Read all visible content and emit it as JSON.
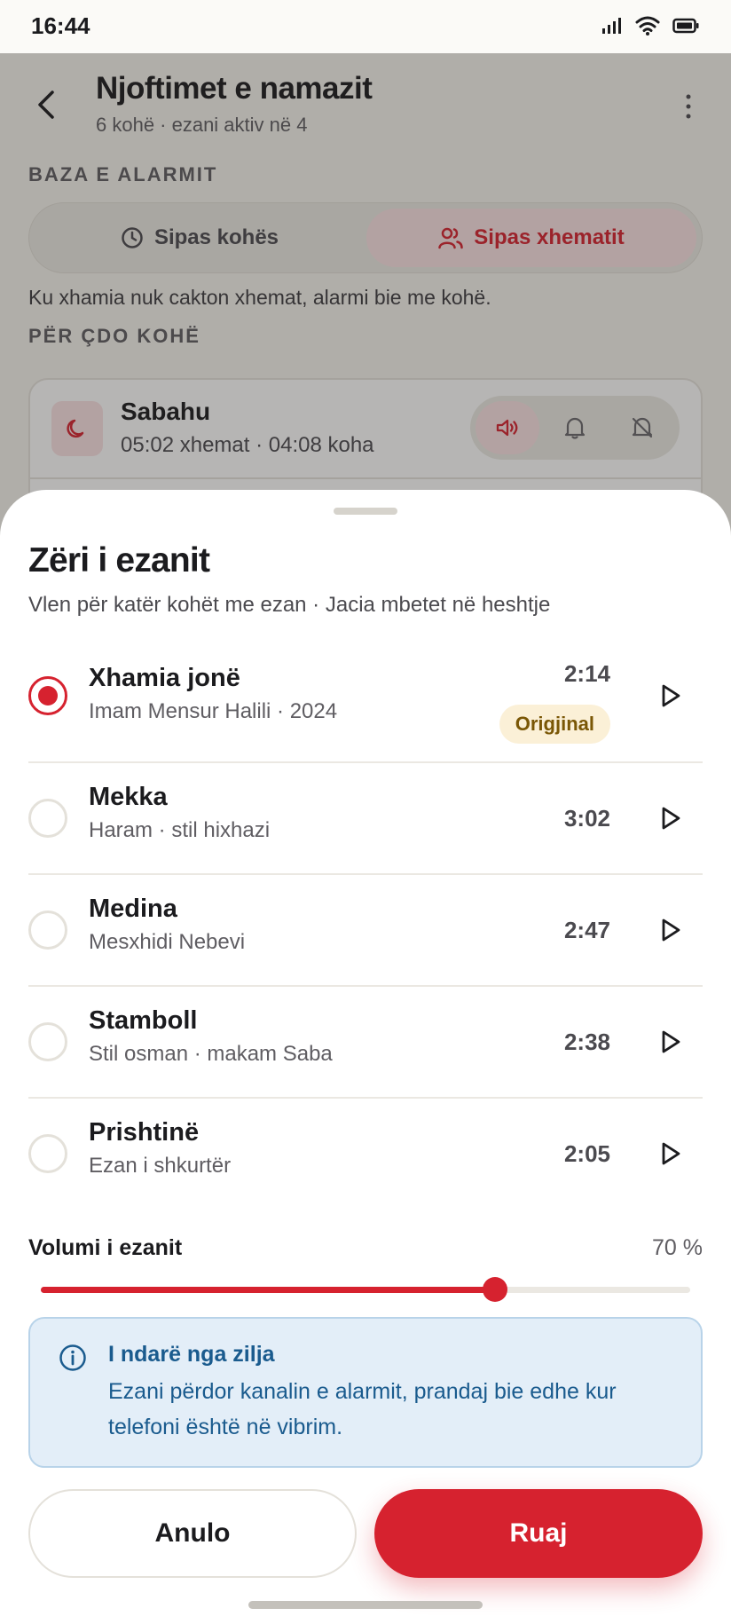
{
  "status": {
    "time": "16:44"
  },
  "header": {
    "title": "Njoftimet e namazit",
    "subtitle": "6 kohë · ezani aktiv në 4"
  },
  "alarm_base": {
    "label": "BAZA E ALARMIT",
    "options": [
      {
        "label": "Sipas kohës",
        "selected": false
      },
      {
        "label": "Sipas xhematit",
        "selected": true
      }
    ],
    "note": "Ku xhamia nuk cakton xhemat, alarmi bie me kohë."
  },
  "per_prayer": {
    "label": "PËR ÇDO KOHË",
    "items": [
      {
        "name": "Sabahu",
        "times": "05:02 xhemat · 04:08 koha",
        "mode": "sound"
      }
    ]
  },
  "sheet": {
    "title": "Zëri i ezanit",
    "subtitle": "Vlen për katër kohët me ezan · Jacia mbetet në heshtje",
    "options": [
      {
        "title": "Xhamia jonë",
        "subtitle": "Imam Mensur Halili · 2024",
        "duration": "2:14",
        "badge": "Origjinal",
        "selected": true
      },
      {
        "title": "Mekka",
        "subtitle": "Haram · stil hixhazi",
        "duration": "3:02",
        "selected": false
      },
      {
        "title": "Medina",
        "subtitle": "Mesxhidi Nebevi",
        "duration": "2:47",
        "selected": false
      },
      {
        "title": "Stamboll",
        "subtitle": "Stil osman · makam Saba",
        "duration": "2:38",
        "selected": false
      },
      {
        "title": "Prishtinë",
        "subtitle": "Ezan i shkurtër",
        "duration": "2:05",
        "selected": false
      }
    ],
    "volume": {
      "label": "Volumi i ezanit",
      "value_text": "70 %",
      "value": 0.7
    },
    "info": {
      "title": "I ndarë nga zilja",
      "text": "Ezani përdor kanalin e alarmit, prandaj bie edhe kur telefoni është në vibrim."
    },
    "buttons": {
      "cancel": "Anulo",
      "save": "Ruaj"
    }
  },
  "colors": {
    "accent": "#d6222f",
    "info": "#1a5b8e",
    "badge_bg": "#fbf0d7",
    "badge_text": "#7a5706"
  }
}
